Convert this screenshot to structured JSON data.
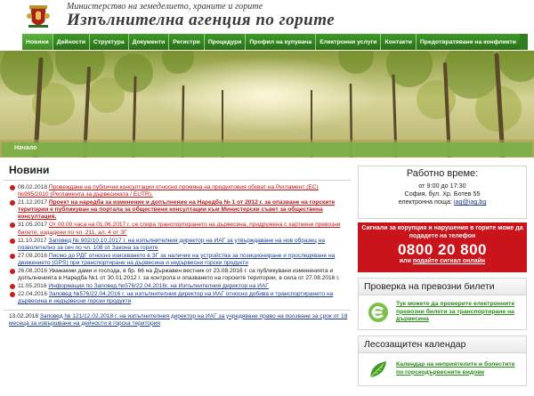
{
  "header": {
    "ministry": "Министерство на земеделието, храните и горите",
    "agency": "Изпълнителна агенция по горите"
  },
  "nav": [
    "Новини",
    "Дейности",
    "Структура",
    "Документи",
    "Регистри",
    "Процедури",
    "Профил на купувача",
    "Електронни услуги",
    "Контакти",
    "Предотвратяване на конфликти"
  ],
  "breadcrumb": "Начало",
  "news": {
    "title": "Новини",
    "items": [
      {
        "date": "08.02.2018",
        "text": "Провеждане на публични консултации относно промяна на продуктовия обхват на Регламент (ЕС) №995/2010 (Регламента за дървесината / EUTR).",
        "style": "red"
      },
      {
        "date": "21.12.2017",
        "text": "Проект на наредба за изменение и допълнение на Наредба № 1 от 2012 г. за опазване на горските територии е публикуван на портала за обществени консултации към Министерски съвет за обществена консултация.",
        "style": "red bold"
      },
      {
        "date": "31.05.2017",
        "text": "От 00.00 часа на 01.06.2017 г. се спира транспортирането на дървесина, придружена с хартиени превозни билети, издадени по чл. 211, ал. 4 от ЗГ",
        "style": "red"
      },
      {
        "date": "11.10.2017",
        "text": "Заповед № 902/10.10.2017 г. на изпълнителния директор на ИАГ за утвърждаване на нов образец на позволително за сеч по чл. 108 от Закона за горите",
        "style": "blue"
      },
      {
        "date": "27.09.2016",
        "text": "Писмо до РДГ относно изискването в ЗГ за наличие на устройства за позициониране и проследяване на движението (GPS) при транспортиране на дървесина и недървесни горски продукти",
        "style": "blue"
      },
      {
        "date": "26.08.2016",
        "text": "Уважаеми дами и господа, в бр. 66 на Държавен вестник от 23.08.2016 г. са публикувани измененията и допълненията в Наредба №1 от 30.01.2012 г. за контрола и опазването на горските територии, в сила от 27.08.2016 г.",
        "style": "plain"
      },
      {
        "date": "11.05.2016",
        "text": "Информация по Заповед №576/22.04.2016г. на Изпълнителния директор на ИАГ",
        "style": "blue"
      },
      {
        "date": "22.04.2016",
        "text": "Заповед №576/22.04.2016 г. на изпълнителния директор на ИАГ относно добива и транспортирането на дървесина и недървесни горски продукти",
        "style": "blue"
      }
    ],
    "tail_date": "13.02.2018",
    "tail_text": "Заповед № 121/12.02.2018 г. на изпълнителния директор на ИАГ за учредяване право на ползване за срок от 18 месеца за извършване на дейности в горска територия"
  },
  "hours": {
    "title": "Работно време:",
    "time": "от 9:00 до 17:30",
    "address": "София, бул. Хр. Ботев 55",
    "email_label": "електронна поща:",
    "email": "iag@iag.bg"
  },
  "corruption": {
    "text": "Сигнали за корупция и нарушения в горите може да подадете на телефон",
    "phone": "0800 20 800",
    "or": "или",
    "link": "подайте сигнал онлайн"
  },
  "tickets": {
    "title": "Проверка на превозни билети",
    "text": "Тук можете да проверите електронните превозни билети за транспортиране на дървесина"
  },
  "calendar": {
    "title": "Лесозащитен календар",
    "text": "Календар на неприятелите и болестите по горскодървесните видове"
  },
  "colors": {
    "nav_green": "#2f7d1e",
    "accent_red": "#c9141b",
    "link_blue": "#1a3d8f",
    "link_green": "#2a8a1a"
  }
}
